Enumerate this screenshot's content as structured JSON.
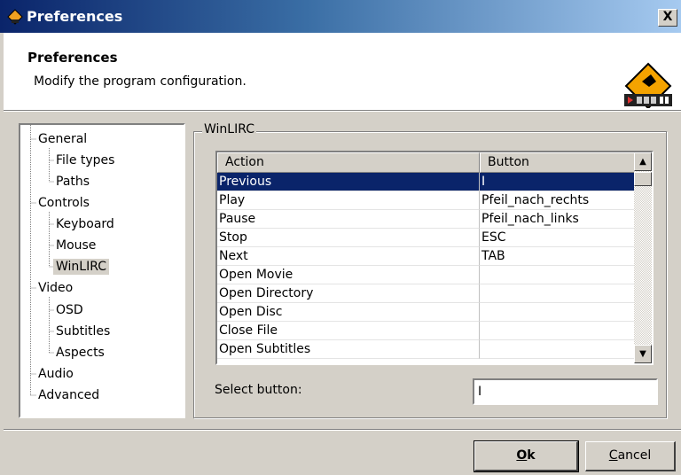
{
  "window": {
    "title": "Preferences",
    "close_glyph": "X"
  },
  "header": {
    "title": "Preferences",
    "subtitle": "Modify the program configuration."
  },
  "tree": {
    "items": [
      {
        "label": "General"
      },
      {
        "label": "File types"
      },
      {
        "label": "Paths"
      },
      {
        "label": "Controls"
      },
      {
        "label": "Keyboard"
      },
      {
        "label": "Mouse"
      },
      {
        "label": "WinLIRC"
      },
      {
        "label": "Video"
      },
      {
        "label": "OSD"
      },
      {
        "label": "Subtitles"
      },
      {
        "label": "Aspects"
      },
      {
        "label": "Audio"
      },
      {
        "label": "Advanced"
      }
    ]
  },
  "winlirc": {
    "group_label": "WinLIRC",
    "columns": {
      "action": "Action",
      "button": "Button"
    },
    "rows": [
      {
        "action": "Previous",
        "button": "I"
      },
      {
        "action": "Play",
        "button": "Pfeil_nach_rechts"
      },
      {
        "action": "Pause",
        "button": "Pfeil_nach_links"
      },
      {
        "action": "Stop",
        "button": "ESC"
      },
      {
        "action": "Next",
        "button": "TAB"
      },
      {
        "action": "Open Movie",
        "button": ""
      },
      {
        "action": "Open Directory",
        "button": ""
      },
      {
        "action": "Open Disc",
        "button": ""
      },
      {
        "action": "Close File",
        "button": ""
      },
      {
        "action": "Open Subtitles",
        "button": ""
      }
    ],
    "select_label": "Select button:",
    "select_value": "I"
  },
  "buttons": {
    "ok_mnemonic": "O",
    "ok_rest": "k",
    "cancel_mnemonic": "C",
    "cancel_rest": "ancel"
  },
  "colors": {
    "title_gradient_start": "#0a246a",
    "title_gradient_end": "#a6caf0",
    "selection": "#0a246a",
    "face": "#d4d0c8"
  }
}
